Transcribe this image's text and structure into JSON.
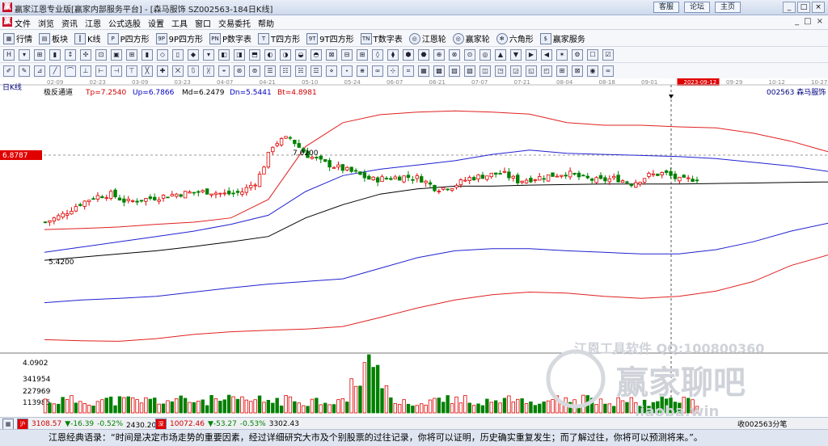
{
  "window": {
    "title": "赢家江恩专业版[赢家内部服务平台] - [森马服饰  SZ002563-184日K线]",
    "links": [
      "客服",
      "论坛",
      "主页"
    ],
    "controls": [
      "_",
      "□",
      "×"
    ]
  },
  "menu": {
    "items": [
      "文件",
      "浏览",
      "资讯",
      "江恩",
      "公式选股",
      "设置",
      "工具",
      "窗口",
      "交易委托",
      "帮助"
    ],
    "mdi_controls": [
      "_",
      "□",
      "×"
    ]
  },
  "toolbar": {
    "buttons": [
      "行情",
      "板块",
      "K线",
      "P四方形",
      "9P四方形",
      "P数字表",
      "T四方形",
      "9T四方形",
      "T数字表",
      "江恩轮",
      "赢家轮",
      "六角形",
      "赢家服务"
    ]
  },
  "chart": {
    "period_label": "日K线",
    "indicator": {
      "name": "极反通道",
      "tp": "Tp=7.2540",
      "up": "Up=6.7866",
      "md": "Md=6.2479",
      "dn": "Dn=5.5441",
      "bt": "Bt=4.8981"
    },
    "stock": "002563  森马服饰",
    "price_axis_label": "6.8787",
    "high_label": "7.0200",
    "low_label": "5.4200",
    "date_labels": [
      "02-09",
      "02-23",
      "03-09",
      "03-23",
      "04-07",
      "04-21",
      "05-10",
      "05-24",
      "06-07",
      "06-21",
      "07-07",
      "07-21",
      "08-04",
      "08-18",
      "09-01",
      "2023-09-12",
      "09-29",
      "10-12",
      "10-27"
    ],
    "volume_max": "4.0902",
    "volume_ticks": [
      "341954",
      "227969",
      "113985"
    ],
    "watermark": {
      "line1": "江恩工具软件  QQ:100800360",
      "line2": "赢家聊吧",
      "line3": "liaoba.win"
    }
  },
  "chart_data": {
    "type": "candlestick",
    "channels": [
      {
        "name": "Tp",
        "values": [
          5.28,
          5.3,
          5.33,
          5.38,
          5.42,
          5.5,
          5.85,
          6.85,
          7.3,
          7.45,
          7.5,
          7.52,
          7.5,
          7.46,
          7.3,
          7.25,
          7.25,
          7.22,
          7.2,
          7.1,
          6.95,
          6.75
        ]
      },
      {
        "name": "Up",
        "values": [
          4.85,
          4.95,
          5.05,
          5.15,
          5.25,
          5.38,
          5.55,
          6.0,
          6.3,
          6.42,
          6.5,
          6.58,
          6.7,
          6.78,
          6.72,
          6.7,
          6.68,
          6.66,
          6.62,
          6.55,
          6.48,
          6.38
        ]
      },
      {
        "name": "Md",
        "values": [
          4.7,
          4.76,
          4.82,
          4.88,
          4.96,
          5.05,
          5.15,
          5.5,
          5.75,
          5.95,
          6.05,
          6.1,
          6.1,
          6.12,
          6.13,
          6.14,
          6.14,
          6.14,
          6.15,
          6.16,
          6.17,
          6.18
        ]
      },
      {
        "name": "Dn",
        "values": [
          3.9,
          3.95,
          3.98,
          4.02,
          4.1,
          4.18,
          4.25,
          4.3,
          4.35,
          4.55,
          4.75,
          4.88,
          4.92,
          4.92,
          4.88,
          4.85,
          4.82,
          4.82,
          4.9,
          5.05,
          5.25,
          5.4
        ]
      },
      {
        "name": "Bt",
        "values": [
          3.2,
          3.18,
          3.17,
          3.22,
          3.3,
          3.35,
          3.38,
          3.4,
          3.45,
          3.62,
          3.8,
          3.95,
          4.05,
          4.1,
          4.08,
          4.02,
          3.98,
          4.02,
          4.12,
          4.3,
          4.6,
          4.8
        ]
      }
    ],
    "close_path": [
      5.42,
      5.55,
      5.75,
      5.9,
      5.95,
      5.8,
      5.85,
      5.9,
      5.95,
      5.98,
      6.0,
      5.95,
      5.98,
      6.2,
      6.9,
      7.02,
      6.7,
      6.55,
      6.45,
      6.35,
      6.22,
      6.25,
      6.28,
      6.25,
      6.05,
      6.1,
      6.25,
      6.3,
      6.35,
      6.2,
      6.25,
      6.3,
      6.35,
      6.25,
      6.2,
      6.25,
      6.15,
      6.3,
      6.35,
      6.2,
      6.25
    ],
    "y_range": [
      3.1,
      7.8
    ],
    "current_date": "2023-09-12"
  }
}
